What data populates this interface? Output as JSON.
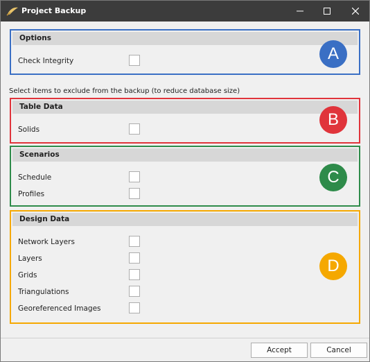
{
  "window": {
    "title": "Project Backup"
  },
  "colors": {
    "section_a": "#3a6fc4",
    "section_b": "#e0343b",
    "section_c": "#2e8b4a",
    "section_d": "#f5a800"
  },
  "sections": {
    "options": {
      "title": "Options",
      "items": [
        {
          "label": "Check Integrity",
          "checked": false
        }
      ],
      "badge": "A"
    },
    "table_data": {
      "title": "Table Data",
      "items": [
        {
          "label": "Solids",
          "checked": false
        }
      ],
      "badge": "B"
    },
    "scenarios": {
      "title": "Scenarios",
      "items": [
        {
          "label": "Schedule",
          "checked": false
        },
        {
          "label": "Profiles",
          "checked": false
        }
      ],
      "badge": "C"
    },
    "design_data": {
      "title": "Design Data",
      "items": [
        {
          "label": "Network Layers",
          "checked": false
        },
        {
          "label": "Layers",
          "checked": false
        },
        {
          "label": "Grids",
          "checked": false
        },
        {
          "label": "Triangulations",
          "checked": false
        },
        {
          "label": "Georeferenced Images",
          "checked": false
        }
      ],
      "badge": "D"
    }
  },
  "exclude_note": "Select items to exclude from the backup (to reduce database size)",
  "buttons": {
    "accept": "Accept",
    "cancel": "Cancel"
  }
}
